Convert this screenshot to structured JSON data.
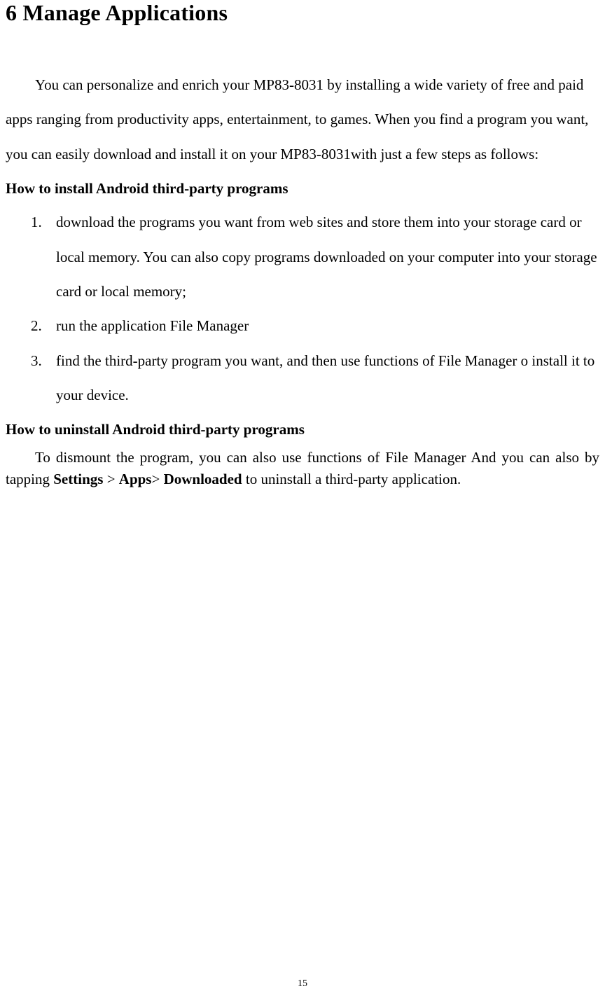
{
  "heading": "6 Manage Applications",
  "intro": "You can personalize and enrich your MP83-8031 by installing a wide variety of free and paid apps ranging from productivity apps, entertainment, to games. When you find a program you want, you can easily download and install it on your MP83-8031with just a few steps as follows:",
  "install_heading": "How to install Android third-party programs",
  "install_steps": {
    "num1": "1.",
    "step1": "download the programs you want from web sites and store them into your storage card or local memory. You can also copy programs downloaded on your computer into your storage card or local memory;",
    "num2": "2.",
    "step2": "run the application File Manager",
    "num3": "3.",
    "step3": "find the third-party program you want, and then use functions of File Manager o install it to your device."
  },
  "uninstall_heading": "How to uninstall Android third-party programs",
  "uninstall_text_part1": "To dismount the program, you can also use functions of File Manager And you can also by tapping ",
  "uninstall_bold1": "Settings",
  "uninstall_gt1": " > ",
  "uninstall_bold2": "Apps",
  "uninstall_gt2": "> ",
  "uninstall_bold3": "Downloaded",
  "uninstall_text_part2": " to uninstall a third-party application.",
  "page_number": "15"
}
